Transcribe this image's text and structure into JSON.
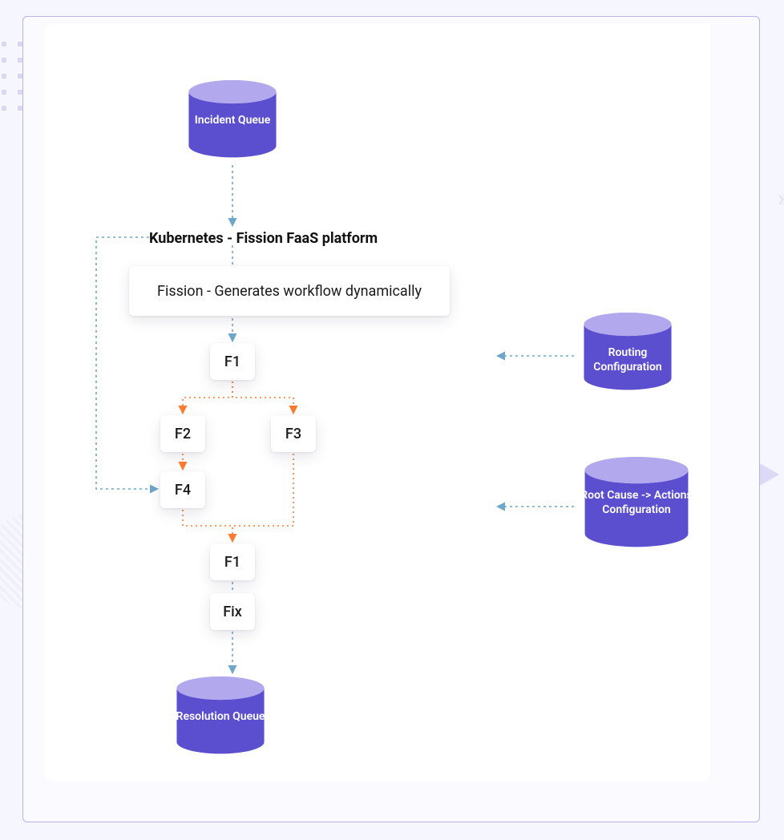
{
  "header": {
    "k8s_title": "Kubernetes - Fission FaaS platform"
  },
  "fission": {
    "card_label": "Fission - Generates workflow dynamically"
  },
  "nodes": {
    "f1": "F1",
    "f2": "F2",
    "f3": "F3",
    "f4": "F4",
    "f1b": "F1",
    "fix": "Fix"
  },
  "cylinders": {
    "incident": "Incident Queue",
    "resolution": "Resolution Queue",
    "routing": "Routing Configuration",
    "rootcause": "Root Cause -> Actions Configuration"
  },
  "colors": {
    "cyl_top": "#b1a8ee",
    "cyl_body": "#5c4fcf",
    "blue_line": "#6da6c9",
    "orange_line": "#ff7a2f",
    "panel_border": "#b8b1f0"
  }
}
